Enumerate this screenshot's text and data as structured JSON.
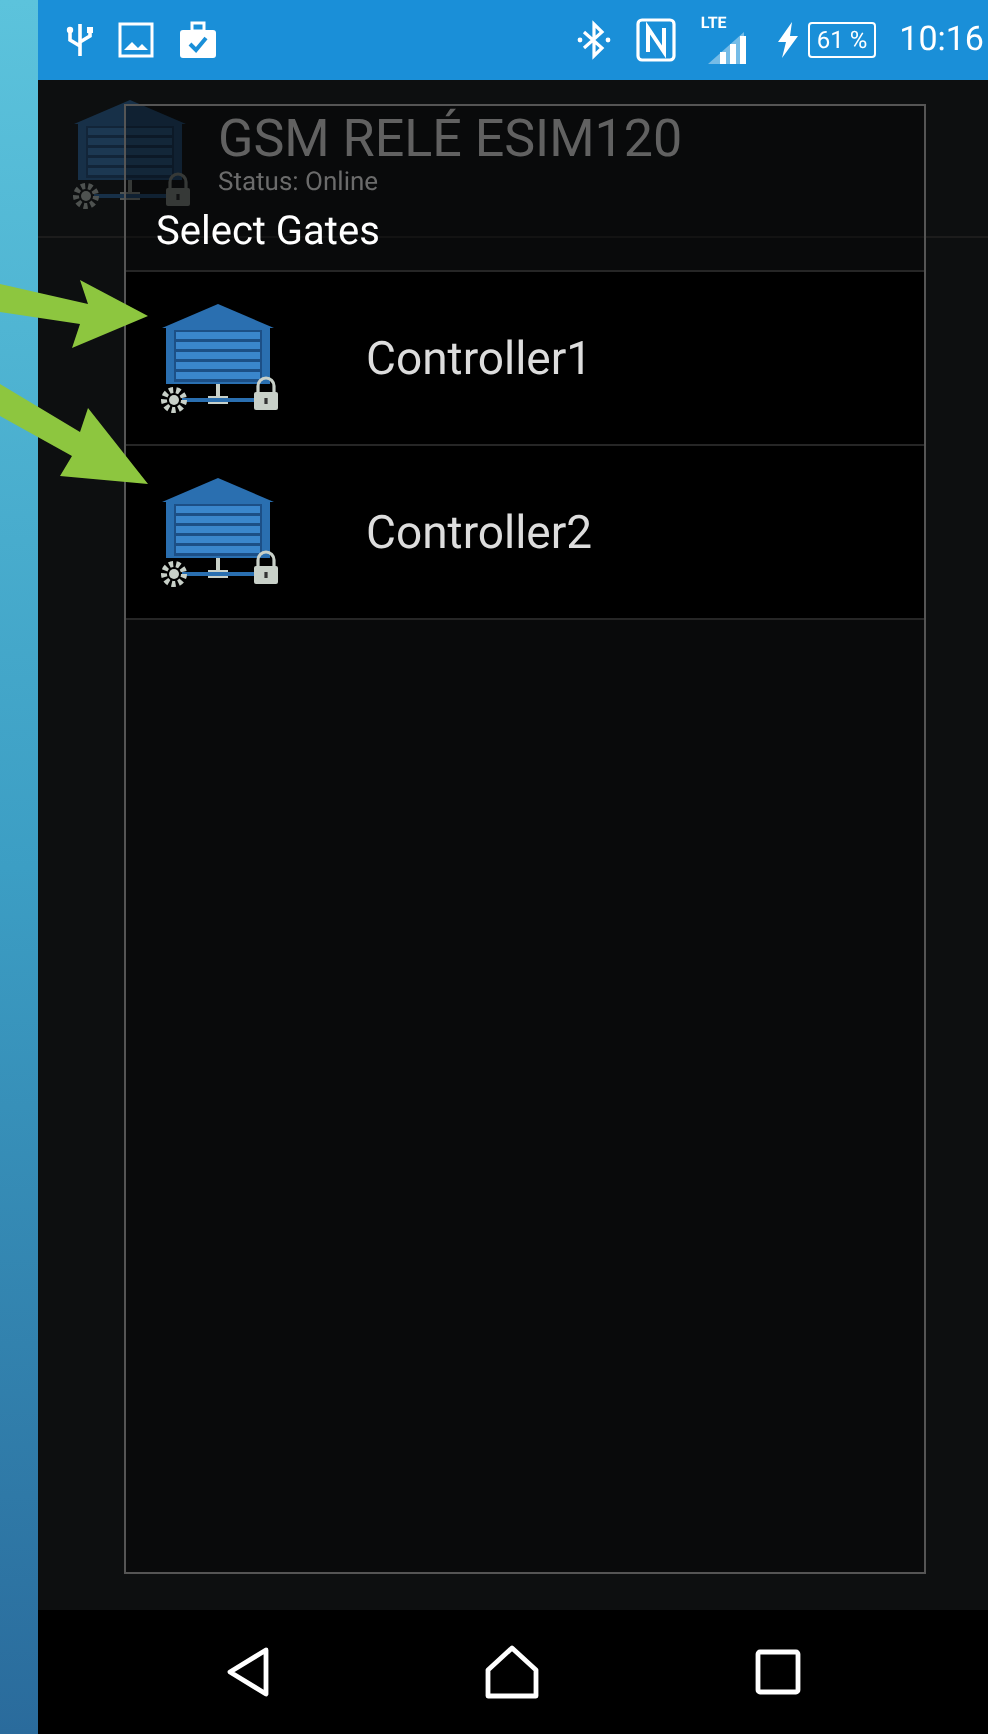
{
  "status_bar": {
    "lte_label": "LTE",
    "battery": "61 %",
    "time": "10:16"
  },
  "app_header": {
    "title": "GSM RELÉ ESIM120",
    "status": "Status: Online"
  },
  "dialog": {
    "title": "Select Gates",
    "items": [
      {
        "label": "Controller1"
      },
      {
        "label": "Controller2"
      }
    ]
  }
}
